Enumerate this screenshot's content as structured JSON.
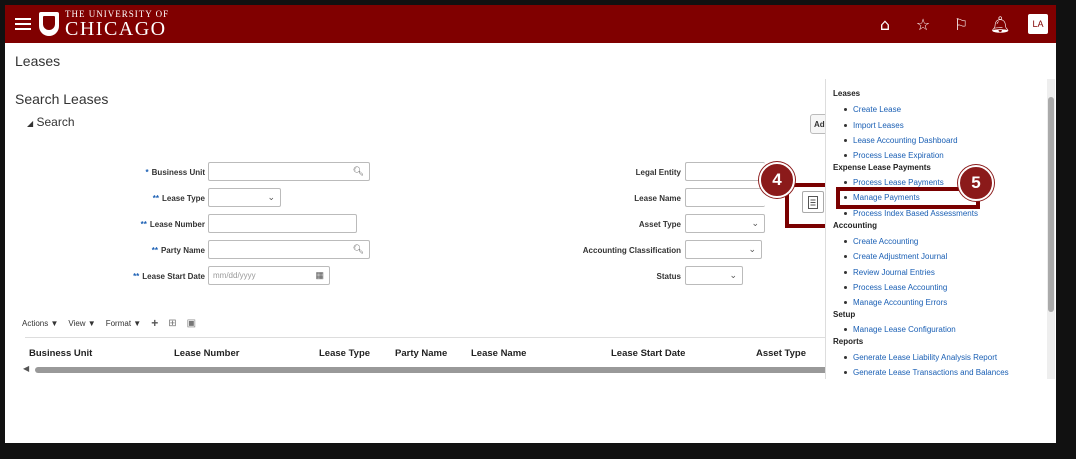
{
  "topbar": {
    "logo_small": "THE UNIVERSITY OF",
    "logo_big": "CHICAGO",
    "avatar": "LA",
    "icons": [
      "home-icon",
      "favorites-icon",
      "flag-icon",
      "bell-icon"
    ]
  },
  "page": {
    "title": "Leases",
    "search_title": "Search Leases",
    "search_toggle": "Search",
    "advanced_label": "Ad"
  },
  "form": {
    "business_unit": {
      "label": "Business Unit",
      "req": "*"
    },
    "lease_type": {
      "label": "Lease Type",
      "req": "**"
    },
    "lease_number": {
      "label": "Lease Number",
      "req": "**"
    },
    "party_name": {
      "label": "Party Name",
      "req": "**"
    },
    "lease_start_date": {
      "label": "Lease Start Date",
      "req": "**",
      "placeholder": "mm/dd/yyyy"
    },
    "legal_entity": {
      "label": "Legal Entity"
    },
    "lease_name": {
      "label": "Lease Name"
    },
    "asset_type": {
      "label": "Asset Type"
    },
    "accounting_classification": {
      "label": "Accounting Classification"
    },
    "status": {
      "label": "Status"
    }
  },
  "toolbar": {
    "actions": "Actions",
    "view": "View",
    "format": "Format"
  },
  "table": {
    "columns": [
      "Business Unit",
      "Lease Number",
      "Lease Type",
      "Party Name",
      "Lease Name",
      "Lease Start Date",
      "Asset Type"
    ]
  },
  "menu": {
    "groups": [
      {
        "title": "Leases",
        "items": [
          "Create Lease",
          "Import Leases",
          "Lease Accounting Dashboard",
          "Process Lease Expiration"
        ]
      },
      {
        "title": "Expense Lease Payments",
        "items": [
          "Process Lease Payments",
          "Manage Payments",
          "Process Index Based Assessments"
        ]
      },
      {
        "title": "Accounting",
        "items": [
          "Create Accounting",
          "Create Adjustment Journal",
          "Review Journal Entries",
          "Process Lease Accounting",
          "Manage Accounting Errors"
        ]
      },
      {
        "title": "Setup",
        "items": [
          "Manage Lease Configuration"
        ]
      },
      {
        "title": "Reports",
        "items": [
          "Generate Lease Liability Analysis Report",
          "Generate Lease Transactions and Balances"
        ]
      }
    ]
  },
  "callouts": {
    "step4": "4",
    "step5": "5"
  },
  "colors": {
    "brand": "#800000",
    "link": "#1a5fb4",
    "callout": "#7a0000"
  }
}
